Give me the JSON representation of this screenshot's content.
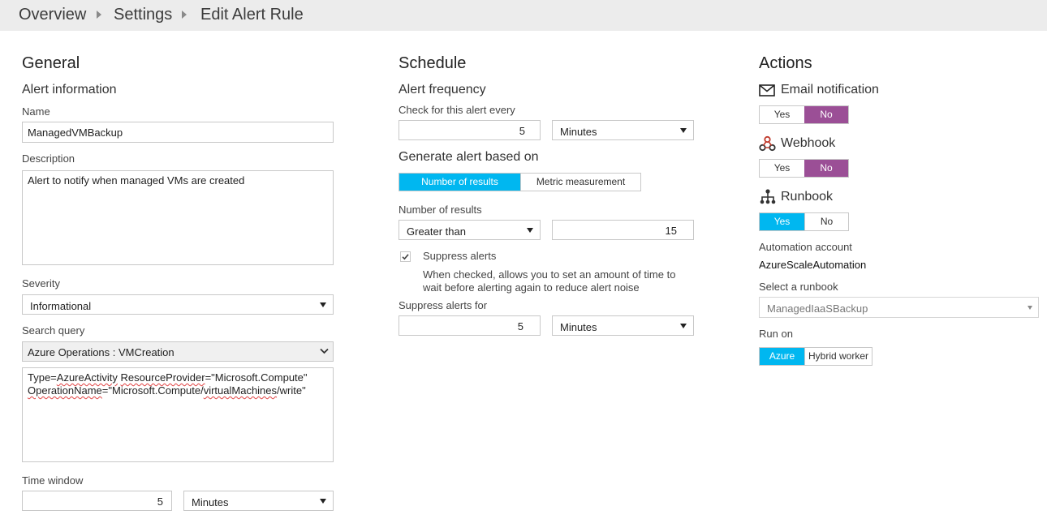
{
  "breadcrumb": {
    "items": [
      "Overview",
      "Settings",
      "Edit Alert Rule"
    ]
  },
  "general": {
    "title": "General",
    "alert_info_title": "Alert information",
    "name_label": "Name",
    "name_value": "ManagedVMBackup",
    "description_label": "Description",
    "description_value": "Alert to notify when managed VMs are created",
    "severity_label": "Severity",
    "severity_value": "Informational",
    "search_query_label": "Search query",
    "search_query_select": "Azure Operations : VMCreation",
    "query_line1_a": "Type=",
    "query_line1_b": "AzureActivity",
    "query_line1_c": " ",
    "query_line1_d": "ResourceProvider",
    "query_line1_e": "=\"Microsoft.Compute\"",
    "query_line2_a": "OperationName",
    "query_line2_b": "=\"Microsoft.Compute/",
    "query_line2_c": "virtualMachines",
    "query_line2_d": "/write\"",
    "time_window_label": "Time window",
    "time_window_value": "5",
    "time_window_unit": "Minutes"
  },
  "schedule": {
    "title": "Schedule",
    "frequency_title": "Alert frequency",
    "check_label": "Check for this alert every",
    "check_value": "5",
    "check_unit": "Minutes",
    "generate_title": "Generate alert based on",
    "tab_results": "Number of results",
    "tab_metric": "Metric measurement",
    "results_label": "Number of results",
    "comparison_value": "Greater than",
    "threshold_value": "15",
    "suppress_label": "Suppress alerts",
    "suppress_checked": true,
    "suppress_help_1": "When checked, allows you to set an amount of time to",
    "suppress_help_2": "wait before alerting again to reduce alert noise",
    "suppress_for_label": "Suppress alerts for",
    "suppress_value": "5",
    "suppress_unit": "Minutes"
  },
  "actions": {
    "title": "Actions",
    "email_label": "Email notification",
    "email_yes": "Yes",
    "email_no": "No",
    "webhook_label": "Webhook",
    "webhook_yes": "Yes",
    "webhook_no": "No",
    "runbook_label": "Runbook",
    "runbook_yes": "Yes",
    "runbook_no": "No",
    "automation_label": "Automation account",
    "automation_value": "AzureScaleAutomation",
    "select_runbook_label": "Select a runbook",
    "runbook_value": "ManagedIaaSBackup",
    "run_on_label": "Run on",
    "run_azure": "Azure",
    "run_hybrid": "Hybrid worker"
  },
  "colors": {
    "purple": "#9b4f96",
    "blue": "#00b7f0",
    "topbar": "#ececec"
  },
  "icons": {
    "email": "envelope-icon",
    "webhook": "webhook-icon",
    "runbook": "runbook-tree-icon",
    "check": "checkbox-checked-icon"
  }
}
